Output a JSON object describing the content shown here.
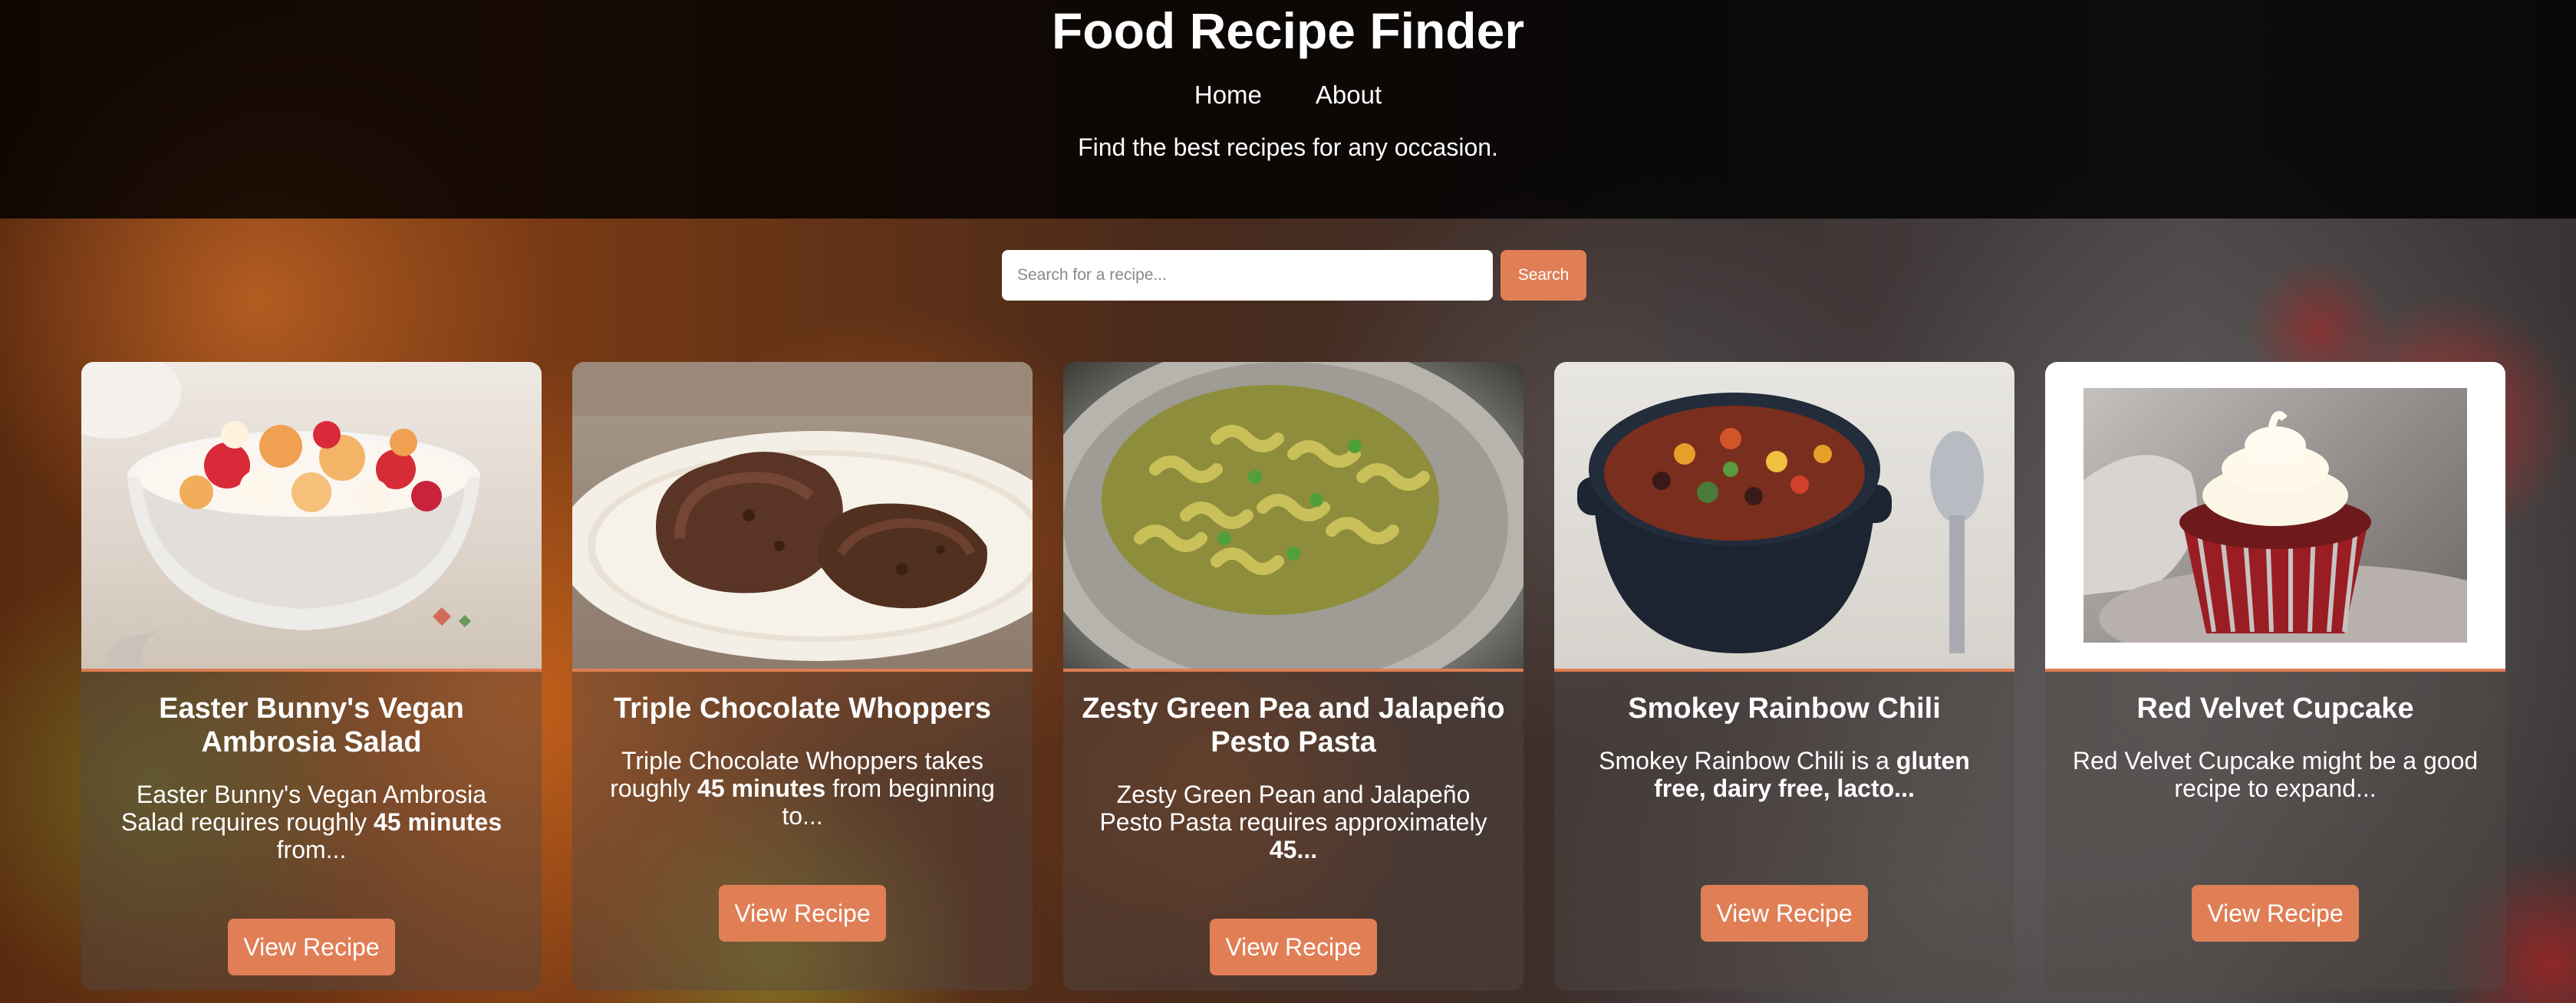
{
  "header": {
    "title": "Food Recipe Finder",
    "nav": [
      {
        "label": "Home"
      },
      {
        "label": "About"
      }
    ],
    "tagline": "Find the best recipes for any occasion."
  },
  "search": {
    "placeholder": "Search for a recipe...",
    "value": "",
    "button_label": "Search"
  },
  "recipes": [
    {
      "title": "Easter Bunny's Vegan Ambrosia Salad",
      "desc_before": "Easter Bunny's Vegan Ambrosia Salad requires roughly ",
      "desc_bold": "45 minutes",
      "desc_after": " from...",
      "button": "View Recipe"
    },
    {
      "title": "Triple Chocolate Whoppers",
      "desc_before": "Triple Chocolate Whoppers takes roughly ",
      "desc_bold": "45 minutes",
      "desc_after": " from beginning to...",
      "button": "View Recipe"
    },
    {
      "title": "Zesty Green Pea and Jalapeño Pesto Pasta",
      "desc_before": "Zesty Green Pean and Jalapeño Pesto Pasta requires approximately ",
      "desc_bold": "45...",
      "desc_after": "",
      "button": "View Recipe"
    },
    {
      "title": "Smokey Rainbow Chili",
      "desc_before": "Smokey Rainbow Chili is a ",
      "desc_bold": "gluten free, dairy free, lacto...",
      "desc_after": "",
      "button": "View Recipe"
    },
    {
      "title": "Red Velvet Cupcake",
      "desc_before": "Red Velvet Cupcake might be a good recipe to expand...",
      "desc_bold": "",
      "desc_after": "",
      "button": "View Recipe"
    }
  ],
  "colors": {
    "accent": "#e07e55",
    "header_bg": "#000000"
  }
}
